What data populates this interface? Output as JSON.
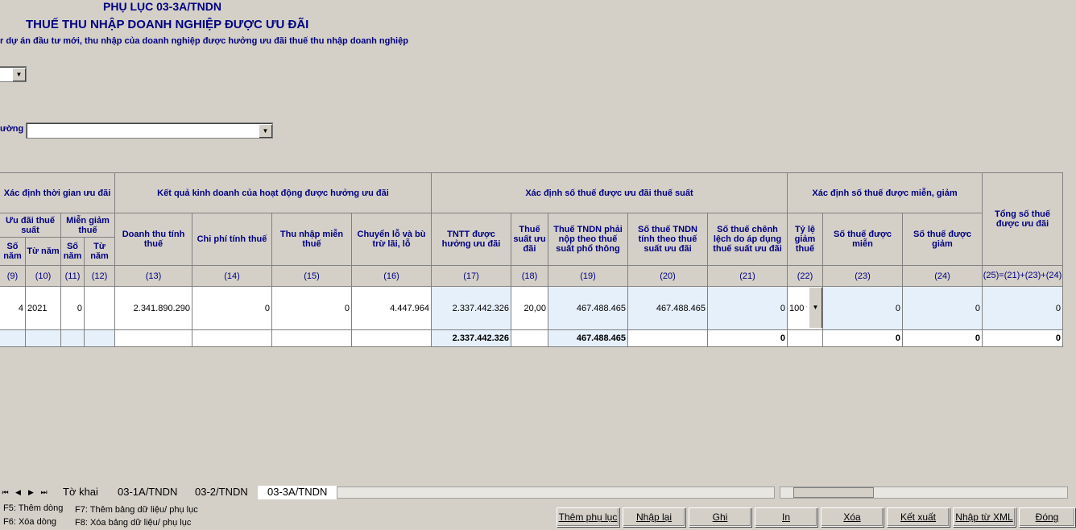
{
  "header": {
    "title_line1": "PHỤ LỤC 03-3A/TNDN",
    "title_line2": "THUẾ THU NHẬP DOANH NGHIỆP ĐƯỢC ƯU ĐÃI",
    "subtitle": "r dự án đầu tư mới, thu nhập của doanh nghiệp được hưởng ưu đãi thuế thu nhập doanh nghiệp",
    "field_label": "ường"
  },
  "table": {
    "groups": {
      "time": "Xác định thời gian ưu đãi",
      "business": "Kết quả kinh doanh của hoạt động được hưởng ưu đãi",
      "tax_rate": "Xác định số thuế được ưu đãi thuế suất",
      "exemption": "Xác định số thuế được miễn, giảm",
      "total": "Tổng số thuế được ưu đãi"
    },
    "subgroups": {
      "incentive_rate": "Ưu đãi thuế suất",
      "exempt_reduce": "Miễn giảm thuế"
    },
    "headers": {
      "c9": "Số năm",
      "c10": "Từ năm",
      "c11": "Số năm",
      "c12": "Từ năm",
      "c13": "Doanh thu tính thuế",
      "c14": "Chi phí tính thuế",
      "c15": "Thu nhập miễn thuế",
      "c16": "Chuyển lỗ và bù trừ lãi, lỗ",
      "c17": "TNTT được hưởng ưu đãi",
      "c18": "Thuế suất ưu đãi",
      "c19": "Thuế TNDN phải nộp theo thuế suất phổ thông",
      "c20": "Số thuế TNDN tính theo thuế suất ưu đãi",
      "c21": "Số thuế chênh lệch do áp dụng thuế suất ưu đãi",
      "c22": "Tỷ lệ giảm thuế",
      "c23": "Số thuế được miễn",
      "c24": "Số thuế được giảm"
    },
    "numbers": {
      "c9": "(9)",
      "c10": "(10)",
      "c11": "(11)",
      "c12": "(12)",
      "c13": "(13)",
      "c14": "(14)",
      "c15": "(15)",
      "c16": "(16)",
      "c17": "(17)",
      "c18": "(18)",
      "c19": "(19)",
      "c20": "(20)",
      "c21": "(21)",
      "c22": "(22)",
      "c23": "(23)",
      "c24": "(24)",
      "c25": "(25)=(21)+(23)+(24)"
    },
    "row": {
      "c9": "4",
      "c10": "2021",
      "c11": "0",
      "c12": "",
      "c13": "2.341.890.290",
      "c14": "0",
      "c15": "0",
      "c16": "4.447.964",
      "c17": "2.337.442.326",
      "c18": "20,00",
      "c19": "467.488.465",
      "c20": "467.488.465",
      "c21": "0",
      "c22": "100 %",
      "c23": "0",
      "c24": "0",
      "c25": "0"
    },
    "totals": {
      "c17": "2.337.442.326",
      "c19": "467.488.465",
      "c21": "0",
      "c23": "0",
      "c24": "0",
      "c25": "0"
    }
  },
  "tabs": [
    "Tờ khai",
    "03-1A/TNDN",
    "03-2/TNDN",
    "03-3A/TNDN"
  ],
  "hints": {
    "f5": "F5: Thêm dòng",
    "f6": "F6: Xóa dòng",
    "f7": "F7: Thêm bảng dữ liệu/ phụ lục",
    "f8": "F8: Xóa bảng dữ liệu/ phụ lục"
  },
  "buttons": [
    "Thêm phụ lục",
    "Nhập lại",
    "Ghi",
    "In",
    "Xóa",
    "Kết xuất",
    "Nhập từ XML",
    "Đóng"
  ]
}
